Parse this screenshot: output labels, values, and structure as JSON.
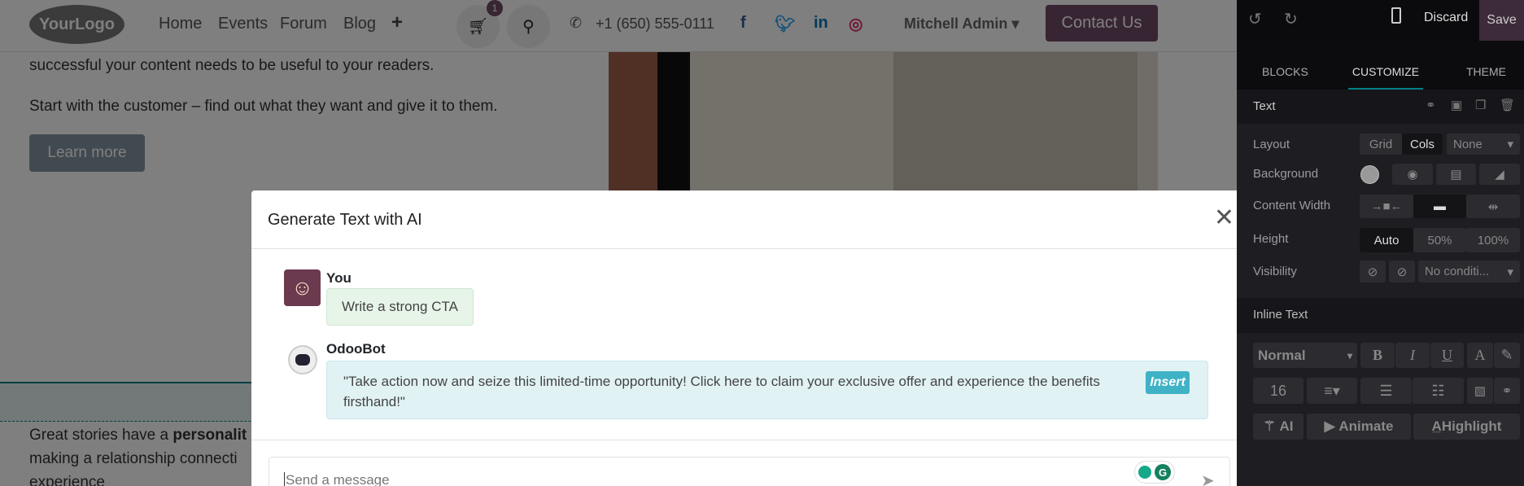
{
  "nav": {
    "logo": "YourLogo",
    "links": [
      "Home",
      "Events",
      "Forum",
      "Blog"
    ],
    "add_icon": "plus-icon",
    "cart_count": "1",
    "phone": "+1 (650) 555-0111",
    "user": "Mitchell Admin",
    "contact_label": "Contact Us"
  },
  "content": {
    "line1": "successful your content needs to be useful to your readers.",
    "line2": "Start with the customer – find out what they want and give it to them.",
    "learn_more": "Learn more",
    "story_pre": "Great stories have a ",
    "story_bold": "personalit",
    "story_line2": "making a relationship connecti",
    "story_line3": "experience"
  },
  "modal": {
    "title": "Generate Text with AI",
    "messages": [
      {
        "author": "You",
        "text": "Write a strong CTA"
      },
      {
        "author": "OdooBot",
        "text": "\"Take action now and seize this limited-time opportunity! Click here to claim your exclusive offer and experience the benefits firsthand!\"",
        "action": "Insert"
      }
    ],
    "input_placeholder": "Send a message"
  },
  "sidebar": {
    "discard": "Discard",
    "save": "Save",
    "tabs": [
      "BLOCKS",
      "CUSTOMIZE",
      "THEME"
    ],
    "active_tab": "CUSTOMIZE",
    "section": "Text",
    "layout": {
      "label": "Layout",
      "options": [
        "Grid",
        "Cols"
      ],
      "active": "Cols",
      "select": "None"
    },
    "background": {
      "label": "Background"
    },
    "content_width": {
      "label": "Content Width"
    },
    "height": {
      "label": "Height",
      "options": [
        "Auto",
        "50%",
        "100%"
      ],
      "active": "Auto"
    },
    "visibility": {
      "label": "Visibility",
      "select": "No conditi..."
    },
    "inline_text": "Inline Text",
    "style_select": "Normal",
    "font_size": "16",
    "ai": "AI",
    "animate": "Animate",
    "highlight": "Highlight"
  },
  "colors": {
    "accent": "#714b67",
    "teal": "#017e84",
    "save_bg": "#3d2a3a"
  }
}
